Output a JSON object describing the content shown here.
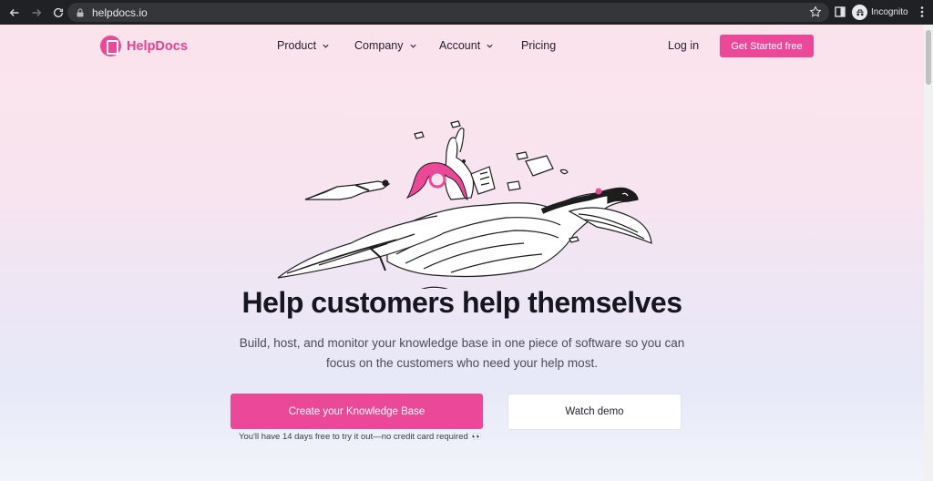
{
  "browser": {
    "url": "helpdocs.io",
    "incognito_label": "Incognito"
  },
  "site": {
    "brand": "HelpDocs",
    "nav": [
      {
        "label": "Product",
        "has_dropdown": true
      },
      {
        "label": "Company",
        "has_dropdown": true
      },
      {
        "label": "Account",
        "has_dropdown": true
      },
      {
        "label": "Pricing",
        "has_dropdown": false
      }
    ],
    "login_label": "Log in",
    "get_started_label": "Get Started free",
    "accent_color": "#ec4899"
  },
  "hero": {
    "headline": "Help customers help themselves",
    "subheadline": "Build, host, and monitor your knowledge base in one piece of software so you can focus on the customers who need your help most.",
    "primary_cta": "Create your Knowledge Base",
    "secondary_cta": "Watch demo",
    "trial_note": "You'll have 14 days free to try it out—no credit card required",
    "trial_note_emoji": "👀"
  }
}
